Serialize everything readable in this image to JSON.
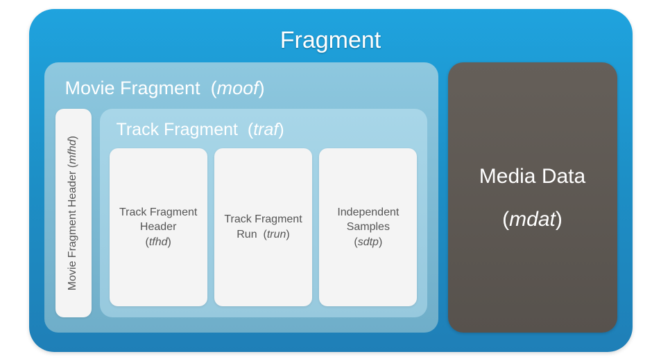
{
  "fragment": {
    "title": "Fragment",
    "moof": {
      "label": "Movie Fragment",
      "code": "moof",
      "mfhd": {
        "label": "Movie Fragment Header",
        "code": "mfhd"
      },
      "traf": {
        "label": "Track Fragment",
        "code": "traf",
        "tfhd": {
          "label": "Track Fragment Header",
          "code": "tfhd"
        },
        "trun": {
          "label": "Track Fragment Run",
          "code": "trun"
        },
        "sdtp": {
          "label": "Independent Samples",
          "code": "sdtp"
        }
      }
    },
    "mdat": {
      "label": "Media Data",
      "code": "mdat"
    }
  }
}
